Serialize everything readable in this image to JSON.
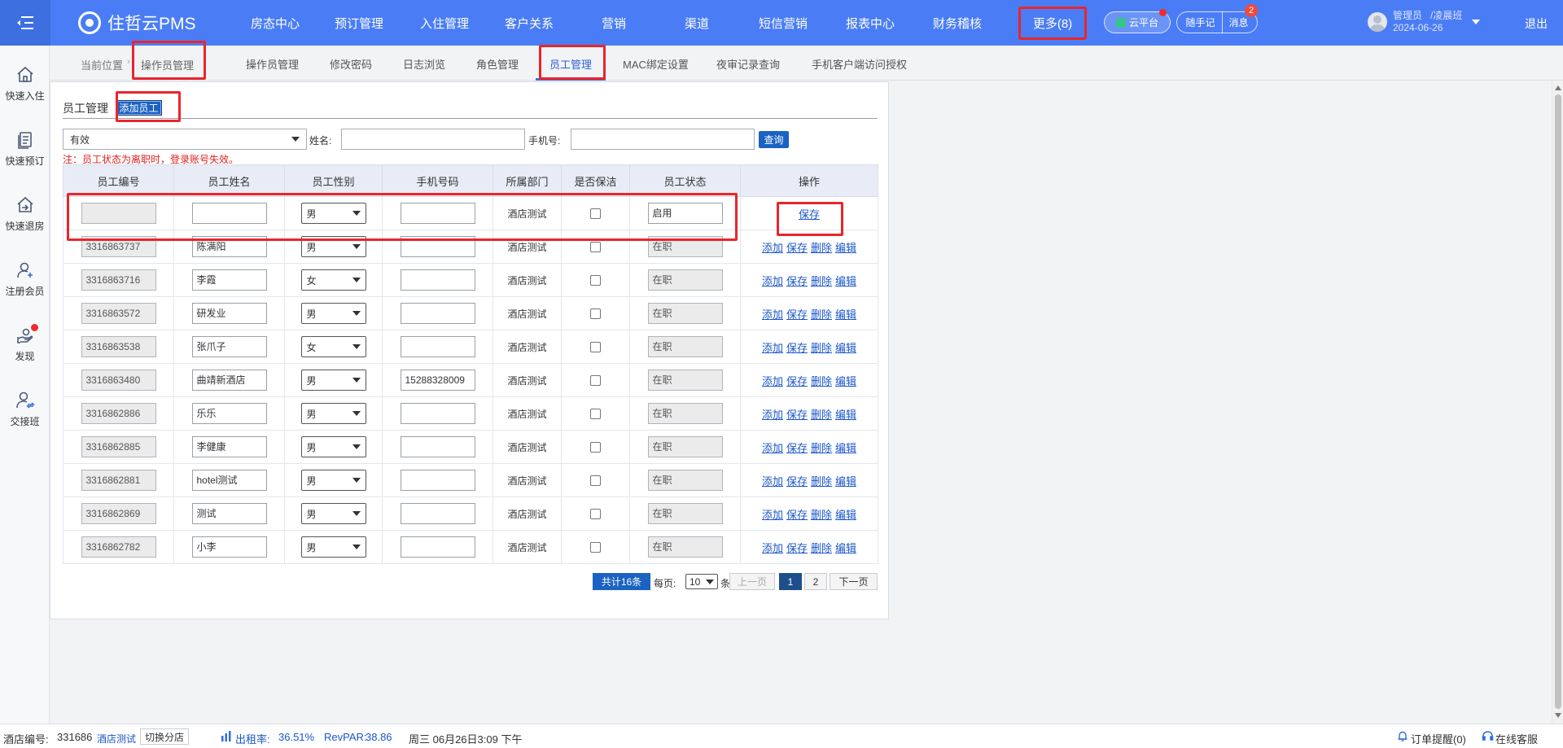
{
  "header": {
    "logo_text": "住哲云PMS",
    "nav": [
      {
        "label": "房态中心"
      },
      {
        "label": "预订管理"
      },
      {
        "label": "入住管理"
      },
      {
        "label": "客户关系"
      },
      {
        "label": "营销"
      },
      {
        "label": "渠道"
      },
      {
        "label": "短信营销"
      },
      {
        "label": "报表中心"
      },
      {
        "label": "财务稽核"
      }
    ],
    "more_label": "更多(8)",
    "cloud_label": "云平台",
    "notes_label": "随手记",
    "messages_label": "消息",
    "messages_badge": "2",
    "user_role": "管理员",
    "user_name": "/凌晨班",
    "user_date": "2024-06-26",
    "logout_label": "退出"
  },
  "sidebar": [
    {
      "label": "快速入住",
      "icon": "home-icon"
    },
    {
      "label": "快速预订",
      "icon": "document-icon"
    },
    {
      "label": "快速退房",
      "icon": "checkout-icon"
    },
    {
      "label": "注册会员",
      "icon": "add-user-icon"
    },
    {
      "label": "发现",
      "icon": "discover-icon"
    },
    {
      "label": "交接班",
      "icon": "shift-handover-icon"
    }
  ],
  "tabs": {
    "breadcrumb_label": "当前位置",
    "breadcrumb_current": "操作员管理",
    "items": [
      {
        "label": "操作员管理"
      },
      {
        "label": "修改密码"
      },
      {
        "label": "日志浏览"
      },
      {
        "label": "角色管理"
      },
      {
        "label": "员工管理"
      },
      {
        "label": "MAC绑定设置"
      },
      {
        "label": "夜审记录查询"
      },
      {
        "label": "手机客户端访问授权"
      }
    ],
    "active": "员工管理"
  },
  "panel": {
    "title": "员工管理",
    "add_button": "添加员工",
    "status_filter": "有效",
    "name_label": "姓名:",
    "phone_label": "手机号:",
    "query_button": "查询",
    "note": "注：员工状态为离职时，登录账号失效。"
  },
  "table": {
    "headers": [
      "员工编号",
      "员工姓名",
      "员工性别",
      "手机号码",
      "所属部门",
      "是否保洁",
      "员工状态",
      "操作"
    ],
    "new_row": {
      "gender": "男",
      "dept": "酒店测试",
      "status": "启用",
      "save": "保存"
    },
    "row_actions": [
      "添加",
      "保存",
      "删除",
      "编辑"
    ],
    "rows": [
      {
        "id": "3316863737",
        "name": "陈满阳",
        "gender": "男",
        "phone": "",
        "dept": "酒店测试",
        "status": "在职"
      },
      {
        "id": "3316863716",
        "name": "李霞",
        "gender": "女",
        "phone": "",
        "dept": "酒店测试",
        "status": "在职"
      },
      {
        "id": "3316863572",
        "name": "研发业",
        "gender": "男",
        "phone": "",
        "dept": "酒店测试",
        "status": "在职"
      },
      {
        "id": "3316863538",
        "name": "张爪子",
        "gender": "女",
        "phone": "",
        "dept": "酒店测试",
        "status": "在职"
      },
      {
        "id": "3316863480",
        "name": "曲靖新酒店",
        "gender": "男",
        "phone": "15288328009",
        "dept": "酒店测试",
        "status": "在职"
      },
      {
        "id": "3316862886",
        "name": "乐乐",
        "gender": "男",
        "phone": "",
        "dept": "酒店测试",
        "status": "在职"
      },
      {
        "id": "3316862885",
        "name": "李健康",
        "gender": "男",
        "phone": "",
        "dept": "酒店测试",
        "status": "在职"
      },
      {
        "id": "3316862881",
        "name": "hotel测试",
        "gender": "男",
        "phone": "",
        "dept": "酒店测试",
        "status": "在职"
      },
      {
        "id": "3316862869",
        "name": "测试",
        "gender": "男",
        "phone": "",
        "dept": "酒店测试",
        "status": "在职"
      },
      {
        "id": "3316862782",
        "name": "小李",
        "gender": "男",
        "phone": "",
        "dept": "酒店测试",
        "status": "在职"
      }
    ]
  },
  "pager": {
    "total": "共计16条",
    "per_page_label": "每页:",
    "per_page": "10",
    "unit": "条",
    "prev": "上一页",
    "pages": [
      "1",
      "2"
    ],
    "current": "1",
    "next": "下一页"
  },
  "statusbar": {
    "hotel_id_label": "酒店编号:",
    "hotel_id": "331686",
    "hotel_name": "酒店测试",
    "switch_branch": "切换分店",
    "occupancy_label": "出租率:",
    "occupancy": "36.51%",
    "revpar_label": "RevPAR:",
    "revpar": "38.86",
    "datetime": "周三 06月26日3:09 下午",
    "order_reminder": "订单提醒(0)",
    "online_service": "在线客服"
  },
  "colors": {
    "topbar": "#4a7df5",
    "primary_button": "#1b62c2",
    "highlight_red": "#e8262c",
    "link_blue": "#1a56c9",
    "note_red": "#e02020"
  }
}
